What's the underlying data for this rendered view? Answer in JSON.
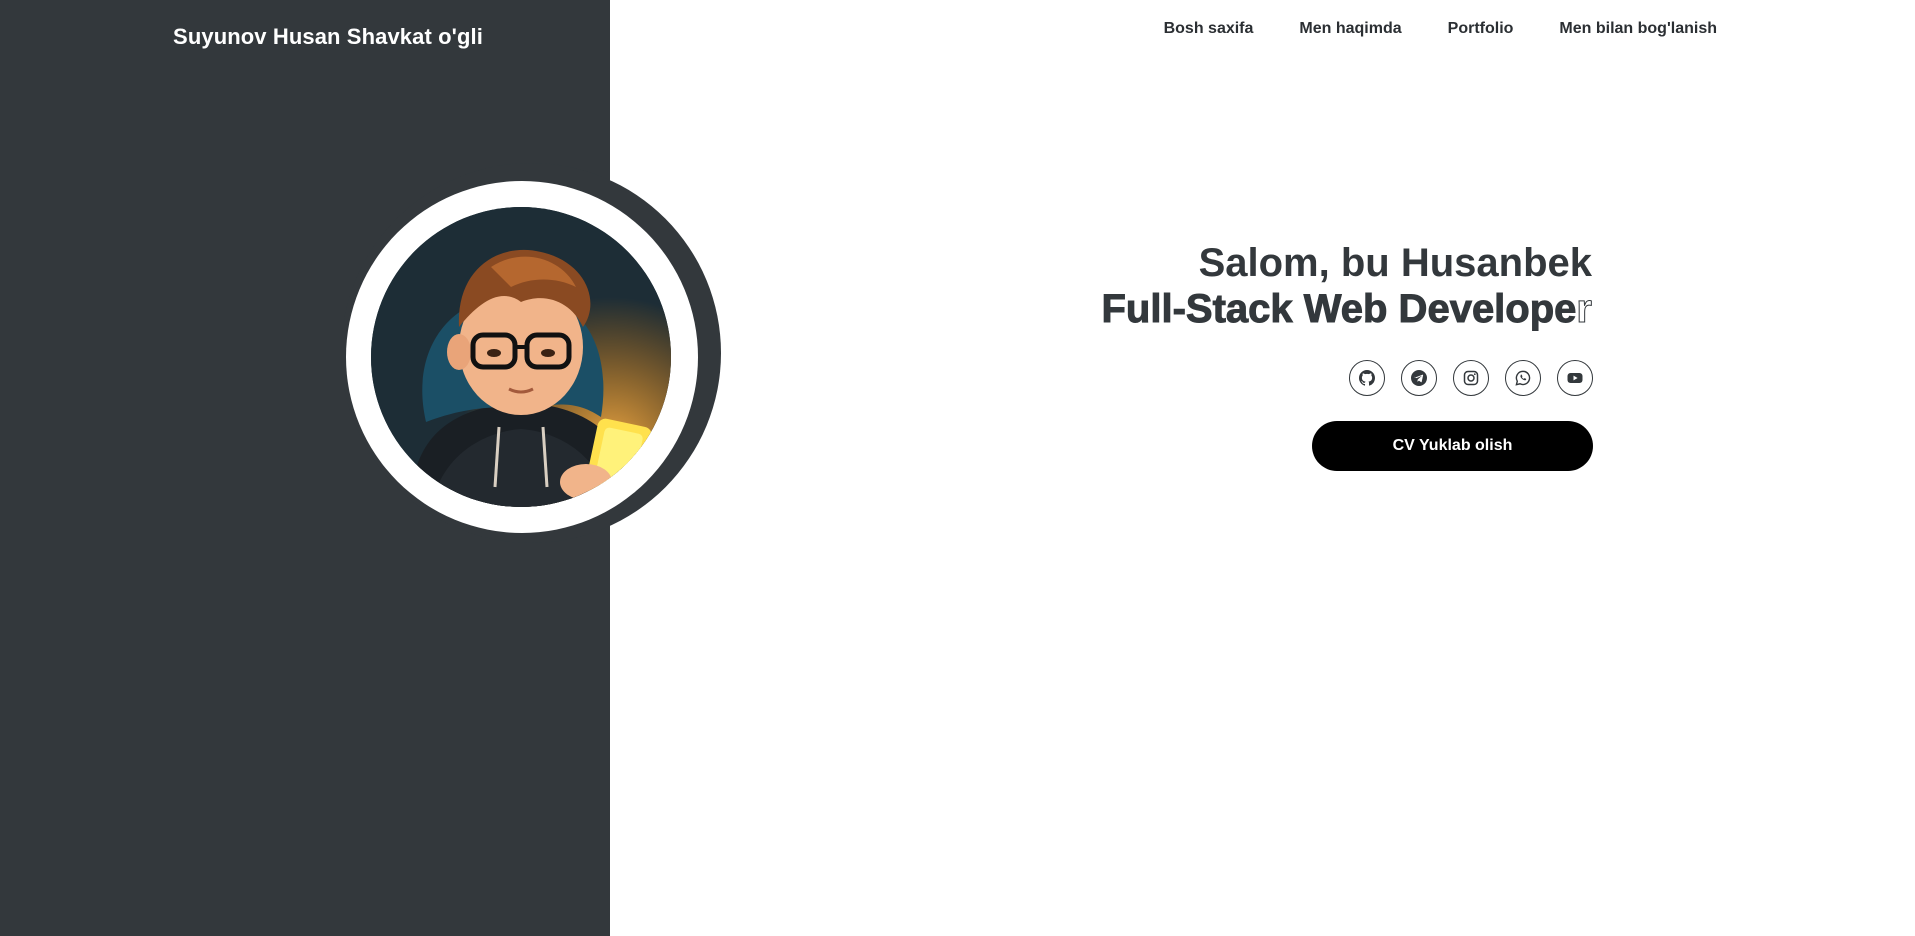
{
  "header": {
    "brand": "Suyunov Husan Shavkat o'gli",
    "nav": [
      {
        "label": "Bosh saxifa"
      },
      {
        "label": "Men haqimda"
      },
      {
        "label": "Portfolio"
      },
      {
        "label": "Men bilan bog'lanish"
      }
    ]
  },
  "hero": {
    "greeting": "Salom, bu Husanbek",
    "title_main": "Full-Stack Web Develope",
    "title_cursor": "r",
    "cv_button": "CV Yuklab olish"
  },
  "socials": [
    {
      "icon": "github-icon"
    },
    {
      "icon": "telegram-icon"
    },
    {
      "icon": "instagram-icon"
    },
    {
      "icon": "whatsapp-icon"
    },
    {
      "icon": "youtube-icon"
    }
  ],
  "colors": {
    "panel": "#33383c",
    "text": "#33383c",
    "button": "#000000"
  }
}
